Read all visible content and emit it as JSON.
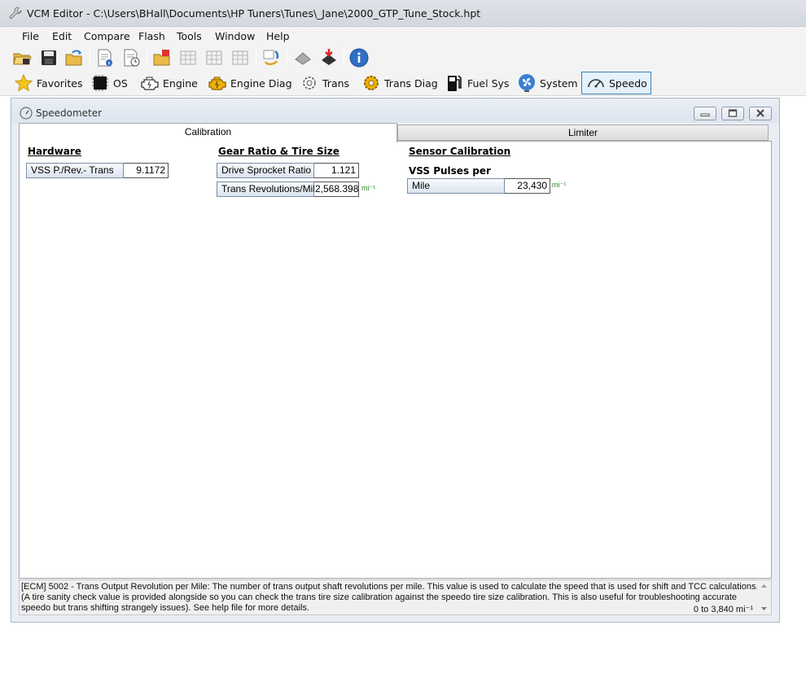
{
  "window": {
    "title": "VCM Editor - C:\\Users\\BHall\\Documents\\HP Tuners\\Tunes\\_Jane\\2000_GTP_Tune_Stock.hpt"
  },
  "menu": [
    "File",
    "Edit",
    "Compare",
    "Flash",
    "Tools",
    "Window",
    "Help"
  ],
  "modules": [
    {
      "label": "Favorites",
      "icon": "star-icon"
    },
    {
      "label": "OS",
      "icon": "chip-icon"
    },
    {
      "label": "Engine",
      "icon": "engine-icon"
    },
    {
      "label": "Engine Diag",
      "icon": "engine-diag-icon"
    },
    {
      "label": "Trans",
      "icon": "gear-icon"
    },
    {
      "label": "Trans Diag",
      "icon": "trans-diag-icon"
    },
    {
      "label": "Fuel Sys",
      "icon": "fuel-pump-icon"
    },
    {
      "label": "System",
      "icon": "fan-icon"
    },
    {
      "label": "Speedo",
      "icon": "speedometer-icon",
      "active": true
    }
  ],
  "editor": {
    "title": "Speedometer",
    "tabs": {
      "calibration": "Calibration",
      "limiter": "Limiter"
    },
    "hardware": {
      "heading": "Hardware",
      "vss_label": "VSS P./Rev.- Trans",
      "vss_value": "9.1172"
    },
    "gear": {
      "heading": "Gear Ratio & Tire Size",
      "sprocket_label": "Drive Sprocket Ratio",
      "sprocket_value": "1.121",
      "trans_rev_label": "Trans Revolutions/Mile",
      "trans_rev_value": "2,568.3983",
      "trans_rev_unit": "mi⁻¹"
    },
    "sensor": {
      "heading": "Sensor Calibration",
      "subheading": "VSS Pulses per",
      "mile_label": "Mile",
      "mile_value": "23,430",
      "mile_unit": "mi⁻¹"
    },
    "description": {
      "text": "[ECM] 5002 - Trans Output Revolution per Mile: The number of trans output shaft revolutions per mile. This value is used to calculate the speed that is used for shift and TCC calculations. (A tire sanity check value is provided alongside so you can check the trans tire size calibration against the speedo tire size calibration. This is also useful for troubleshooting accurate speedo but trans shifting strangely issues). See help file for more details.",
      "range": "0 to 3,840 mi⁻¹"
    }
  },
  "colors": {
    "accent": "#3c7fb1",
    "unit_green": "#2a8a2a",
    "window_frame": "#e9eef5"
  }
}
